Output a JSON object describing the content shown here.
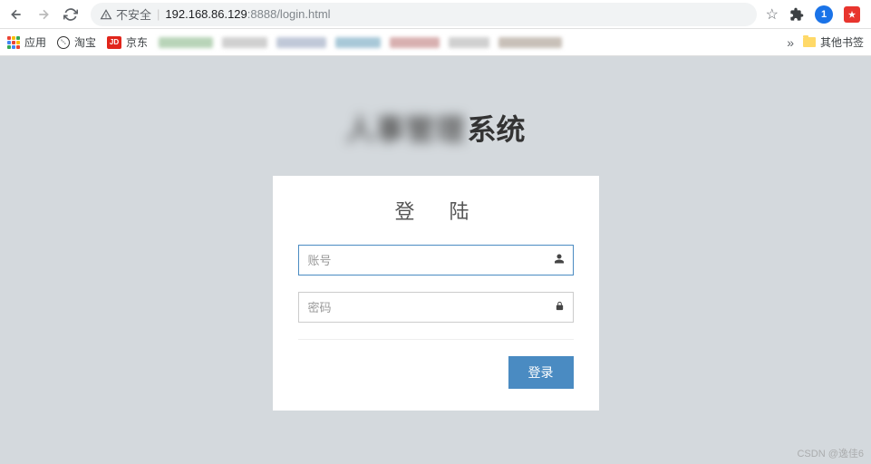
{
  "browser": {
    "security_label": "不安全",
    "url_host": "192.168.86.129",
    "url_port_path": ":8888/login.html",
    "profile_badge": "1"
  },
  "bookmarks": {
    "apps": "应用",
    "taobao": "淘宝",
    "jd": "京东",
    "other": "其他书签",
    "overflow": "»"
  },
  "page": {
    "title_blurred": "人事管理",
    "title_clear": "系统",
    "login_heading": "登　陆",
    "username_placeholder": "账号",
    "password_placeholder": "密码",
    "login_button": "登录",
    "watermark": "CSDN @逸佳6"
  }
}
